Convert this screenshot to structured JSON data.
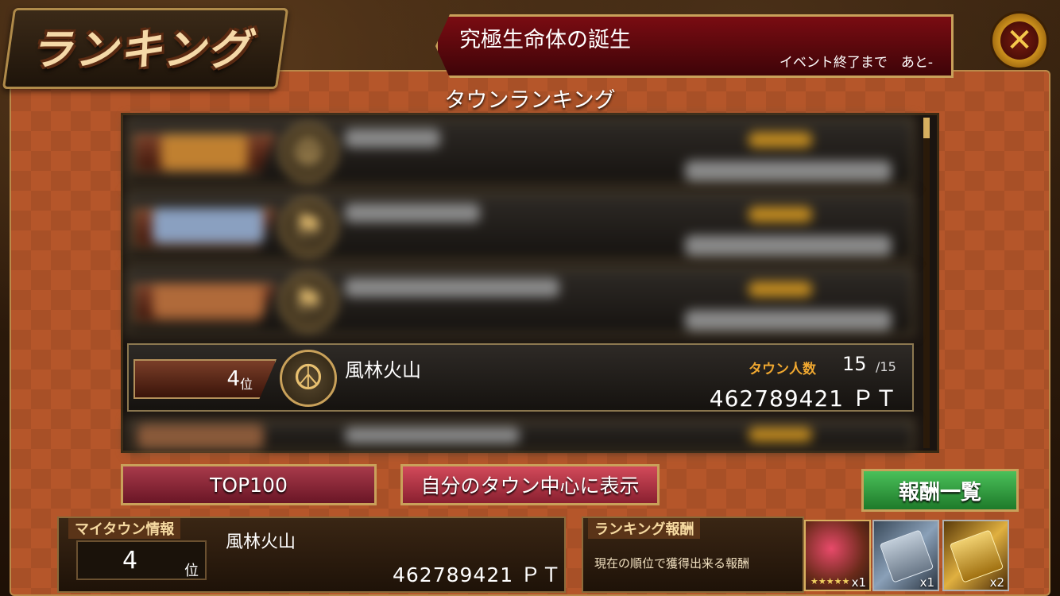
{
  "header": {
    "title": "ランキング",
    "event_title": "究極生命体の誕生",
    "event_remaining": "イベント終了まで　あと-",
    "close_icon": "close-icon"
  },
  "section_title": "タウンランキング",
  "ranking_rows": [
    {
      "rank": "",
      "rank_suffix": "",
      "town": "",
      "member_label": "",
      "members": "",
      "members_max": "",
      "points": "",
      "blurred": true
    },
    {
      "rank": "",
      "rank_suffix": "",
      "town": "",
      "member_label": "",
      "members": "",
      "members_max": "",
      "points": "",
      "blurred": true
    },
    {
      "rank": "",
      "rank_suffix": "",
      "town": "",
      "member_label": "",
      "members": "",
      "members_max": "",
      "points": "",
      "blurred": true
    },
    {
      "rank": "4",
      "rank_suffix": "位",
      "town": "風林火山",
      "member_label": "タウン人数",
      "members": "15",
      "members_max": "/15",
      "points": "462789421 ＰＴ",
      "blurred": false,
      "emblem": "peace-icon"
    },
    {
      "rank": "",
      "rank_suffix": "",
      "town": "",
      "member_label": "",
      "members": "",
      "members_max": "",
      "points": "",
      "blurred": true
    }
  ],
  "buttons": {
    "top100": "TOP100",
    "center_my_town": "自分のタウン中心に表示",
    "reward_list": "報酬一覧"
  },
  "my_town": {
    "label": "マイタウン情報",
    "rank": "4",
    "rank_suffix": "位",
    "name": "風林火山",
    "points": "462789421 ＰＴ"
  },
  "ranking_reward": {
    "label": "ランキング報酬",
    "description": "現在の順位で獲得出来る報酬",
    "items": [
      {
        "icon": "character-card-icon",
        "count": "x1"
      },
      {
        "icon": "silver-ticket-icon",
        "count": "x1"
      },
      {
        "icon": "gold-ticket-icon",
        "count": "x2"
      }
    ]
  },
  "colors": {
    "panel": "#b5562a",
    "event_banner": "#7a0c12",
    "member_label": "#f0a830",
    "reward_button": "#4ac05a"
  }
}
